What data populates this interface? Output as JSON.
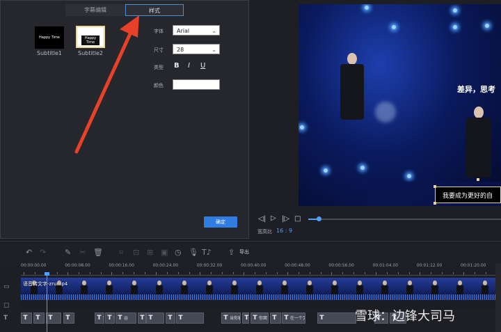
{
  "tabs": [
    {
      "label": "字幕编辑",
      "active": false
    },
    {
      "label": "样式",
      "active": true
    }
  ],
  "templates": [
    {
      "label": "Subtitle1",
      "preview_text": "Happy Time"
    },
    {
      "label": "Subtitle2",
      "preview_text": "Happy Time"
    }
  ],
  "style": {
    "font_label": "字体",
    "font_value": "Arial",
    "size_label": "尺寸",
    "size_value": "28",
    "type_label": "类型",
    "bold": "B",
    "italic": "I",
    "underline": "U",
    "color_label": "颜色",
    "color_value": "#ffffff"
  },
  "confirm_label": "确定",
  "preview": {
    "stage_text": "差异，思考",
    "subtitle_text": "我要成为更好的自"
  },
  "player": {
    "ratio_label": "宽高比",
    "ratio_value": "16 : 9",
    "progress": 0.05
  },
  "toolbar": {
    "export_label": "导出"
  },
  "timeline": {
    "ticks": [
      "00:00:00.00",
      "00:00:08.00",
      "00:00:16.00",
      "00:00:24.00",
      "00:00:32.00",
      "00:00:40.00",
      "00:00:48.00",
      "00:00:56.00",
      "00:01:04.00",
      "00:01:12.00",
      "00:01:20.00"
    ],
    "clip_title": "语音转文字-zrump4",
    "text_chips": [
      "",
      "",
      "",
      "",
      "我2",
      "我为I",
      "谷",
      "右",
      "",
      "",
      "",
      "当你被",
      "",
      "你窝",
      "",
      "在一个又一",
      "",
      "",
      ""
    ]
  },
  "watermark": "雪球：边锋大司马",
  "colors": {
    "accent": "#2f7de1",
    "highlight": "#4ea2ff",
    "selection": "#e9d694"
  }
}
